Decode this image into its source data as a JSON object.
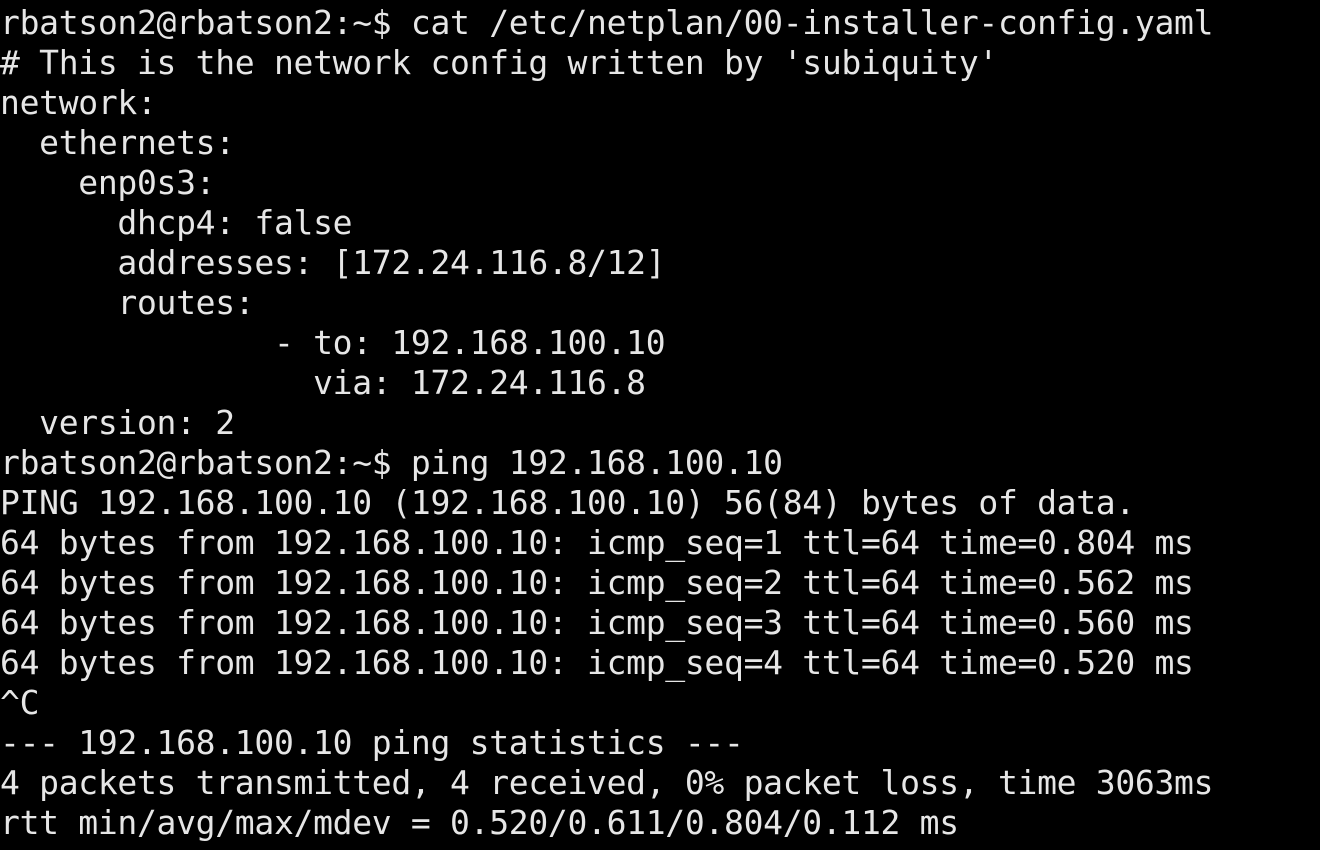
{
  "terminal": {
    "lines": [
      "rbatson2@rbatson2:~$ cat /etc/netplan/00-installer-config.yaml",
      "# This is the network config written by 'subiquity'",
      "network:",
      "  ethernets:",
      "    enp0s3:",
      "      dhcp4: false",
      "      addresses: [172.24.116.8/12]",
      "      routes:",
      "              - to: 192.168.100.10",
      "                via: 172.24.116.8",
      "  version: 2",
      "rbatson2@rbatson2:~$ ping 192.168.100.10",
      "PING 192.168.100.10 (192.168.100.10) 56(84) bytes of data.",
      "64 bytes from 192.168.100.10: icmp_seq=1 ttl=64 time=0.804 ms",
      "64 bytes from 192.168.100.10: icmp_seq=2 ttl=64 time=0.562 ms",
      "64 bytes from 192.168.100.10: icmp_seq=3 ttl=64 time=0.560 ms",
      "64 bytes from 192.168.100.10: icmp_seq=4 ttl=64 time=0.520 ms",
      "^C",
      "--- 192.168.100.10 ping statistics ---",
      "4 packets transmitted, 4 received, 0% packet loss, time 3063ms",
      "rtt min/avg/max/mdev = 0.520/0.611/0.804/0.112 ms"
    ],
    "colors": {
      "background": "#000000",
      "foreground": "#e6e6e6"
    }
  }
}
